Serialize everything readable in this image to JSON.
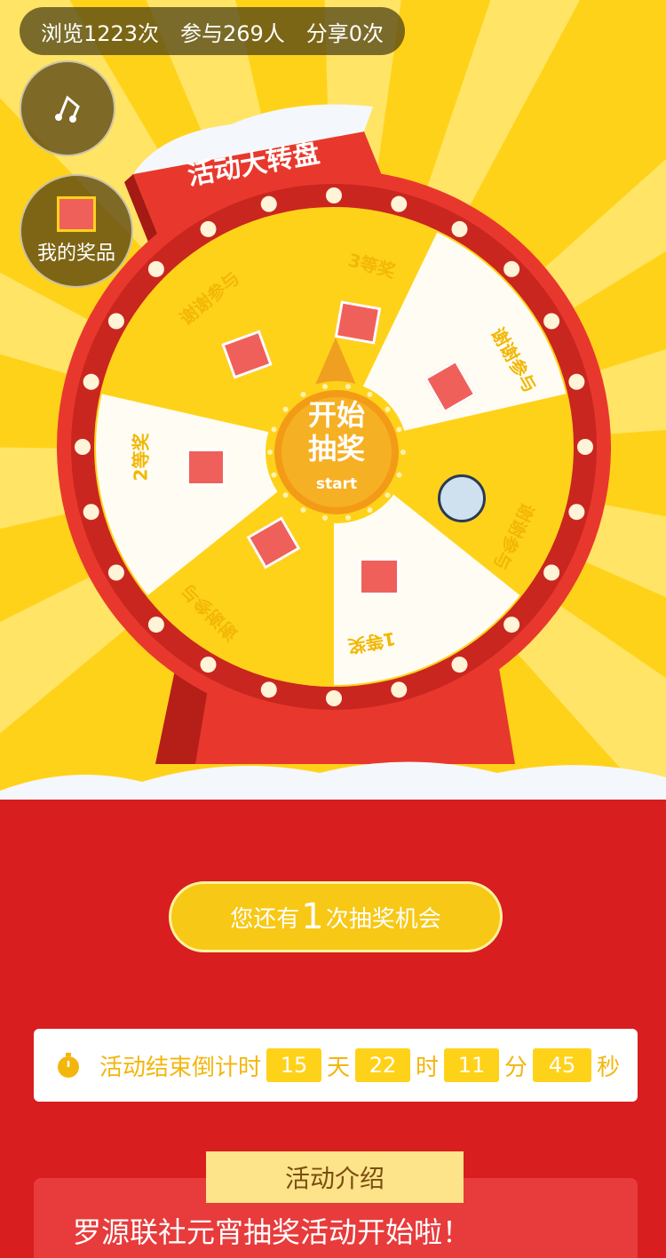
{
  "stats": {
    "views": "浏览1223次",
    "participants": "参与269人",
    "shares": "分享0次"
  },
  "sidebar": {
    "prizes_label": "我的奖品"
  },
  "wheel": {
    "title": "活动大转盘",
    "start_main": "开始\n抽奖",
    "start_line1": "开始",
    "start_line2": "抽奖",
    "start_sub": "start",
    "segments": [
      {
        "label": "3等奖"
      },
      {
        "label": "谢谢参与"
      },
      {
        "label": "谢谢参与"
      },
      {
        "label": "1等奖"
      },
      {
        "label": "谢谢参与"
      },
      {
        "label": "2等奖"
      },
      {
        "label": "谢谢参与"
      }
    ]
  },
  "chance": {
    "prefix": "您还有",
    "count": "1",
    "suffix": "次抽奖机会"
  },
  "countdown": {
    "label": "活动结束倒计时",
    "days": "15",
    "days_unit": "天",
    "hours": "22",
    "hours_unit": "时",
    "minutes": "11",
    "minutes_unit": "分",
    "seconds": "45",
    "seconds_unit": "秒"
  },
  "intro": {
    "title": "活动介绍",
    "text": "罗源联社元宵抽奖活动开始啦！"
  },
  "colors": {
    "yellow": "#ffd21a",
    "red": "#d81e1e",
    "rim": "#e8382d"
  }
}
